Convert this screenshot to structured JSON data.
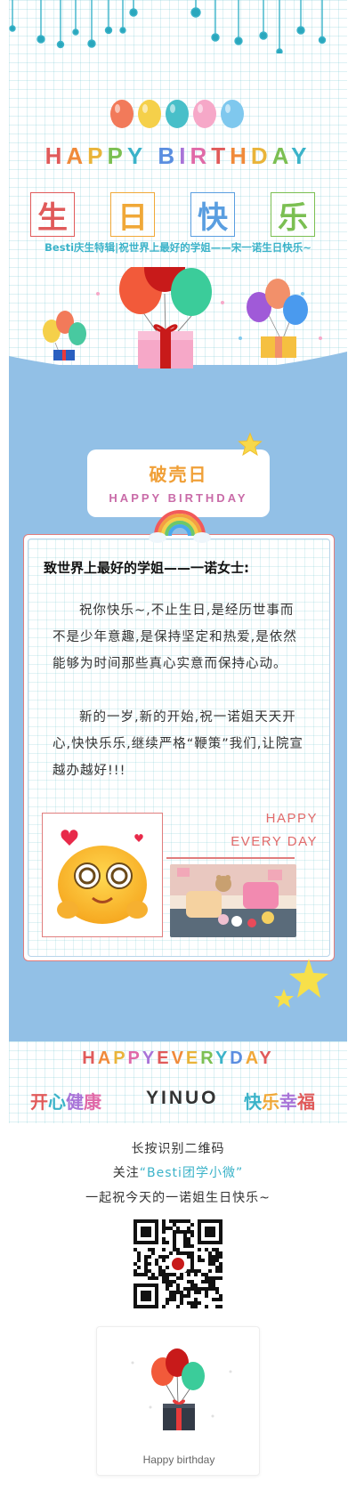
{
  "header": {
    "title_letters": [
      {
        "ch": "H",
        "color": "#e05a5a"
      },
      {
        "ch": "A",
        "color": "#f08a3a"
      },
      {
        "ch": "P",
        "color": "#e9b43a"
      },
      {
        "ch": "P",
        "color": "#7bbf52"
      },
      {
        "ch": "Y",
        "color": "#3bb3c9"
      },
      {
        "ch": " ",
        "color": "#ffffff"
      },
      {
        "ch": "B",
        "color": "#5a8ee0"
      },
      {
        "ch": "I",
        "color": "#a874d8"
      },
      {
        "ch": "R",
        "color": "#e06aa8"
      },
      {
        "ch": "T",
        "color": "#e05a5a"
      },
      {
        "ch": "H",
        "color": "#f08a3a"
      },
      {
        "ch": "D",
        "color": "#e9b43a"
      },
      {
        "ch": "A",
        "color": "#7bbf52"
      },
      {
        "ch": "Y",
        "color": "#3bb3c9"
      }
    ],
    "boxes": [
      {
        "ch": "生",
        "color": "#e05a5a"
      },
      {
        "ch": "日",
        "color": "#f0a838"
      },
      {
        "ch": "快",
        "color": "#5a9ee0"
      },
      {
        "ch": "乐",
        "color": "#7bbf52"
      }
    ],
    "subtitle": "Besti庆生特辑|祝世界上最好的学姐——宋一诺生日快乐~"
  },
  "label_card": {
    "title": "破壳日",
    "subtitle": "HAPPY BIRTHDAY"
  },
  "letter": {
    "heading": "致世界上最好的学姐——一诺女士:",
    "paragraph1": "祝你快乐~,不止生日,是经历世事而不是少年意趣,是保持坚定和热爱,是依然能够为时间那些真心实意而保持心动。",
    "paragraph2": "新的一岁,新的开始,祝一诺姐天天开心,快快乐乐,继续严格“鞭策”我们,让院宣越办越好!!!",
    "happy_line1": "HAPPY",
    "happy_line2": "EVERY DAY"
  },
  "bottom": {
    "hed_letters": [
      {
        "ch": "H",
        "color": "#e05a5a"
      },
      {
        "ch": "A",
        "color": "#f08a3a"
      },
      {
        "ch": "P",
        "color": "#e9b43a"
      },
      {
        "ch": "P",
        "color": "#e06aa8"
      },
      {
        "ch": "Y",
        "color": "#a874d8"
      },
      {
        "ch": "E",
        "color": "#e05a5a"
      },
      {
        "ch": "V",
        "color": "#f08a3a"
      },
      {
        "ch": "E",
        "color": "#e9b43a"
      },
      {
        "ch": "R",
        "color": "#7bbf52"
      },
      {
        "ch": "Y",
        "color": "#3bb3c9"
      },
      {
        "ch": "D",
        "color": "#5a8ee0"
      },
      {
        "ch": "A",
        "color": "#f0a838"
      },
      {
        "ch": "Y",
        "color": "#e05a5a"
      }
    ],
    "word1_chars": [
      {
        "ch": "开",
        "color": "#e05a5a"
      },
      {
        "ch": "心",
        "color": "#3bb3c9"
      },
      {
        "ch": "健",
        "color": "#a874d8"
      },
      {
        "ch": "康",
        "color": "#e06aa8"
      }
    ],
    "word2": "YINUO",
    "word3_chars": [
      {
        "ch": "快",
        "color": "#3bb3c9"
      },
      {
        "ch": "乐",
        "color": "#f0a838"
      },
      {
        "ch": "幸",
        "color": "#a874d8"
      },
      {
        "ch": "福",
        "color": "#e05a5a"
      }
    ],
    "qr_line1": "长按识别二维码",
    "qr_line2_prefix": "关注",
    "qr_line2_highlight": "“Besti团学小微”",
    "qr_line3": "一起祝今天的一诺姐生日快乐~",
    "gift_caption": "Happy birthday"
  }
}
